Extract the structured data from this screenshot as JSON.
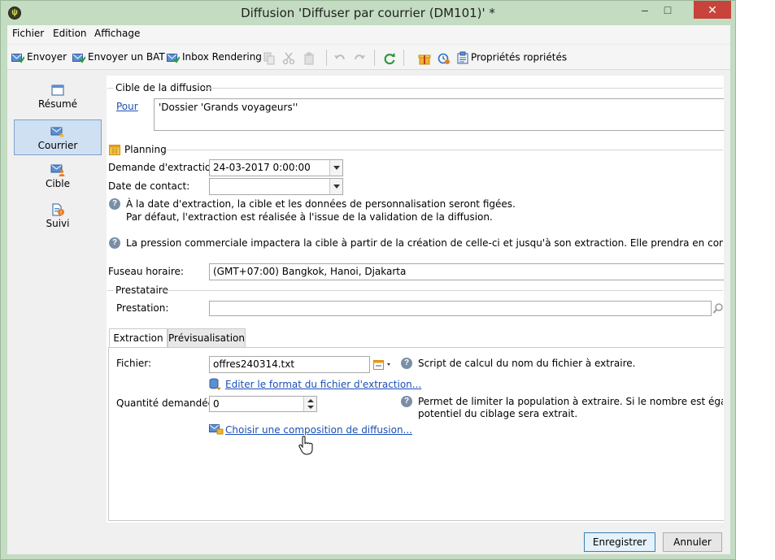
{
  "window": {
    "title": "Diffusion 'Diffuser par courrier (DM101)' *",
    "controls": {
      "minimize": "–",
      "maximize": "□",
      "close": "✕"
    }
  },
  "menu": [
    "Fichier",
    "Edition",
    "Affichage"
  ],
  "toolbar": {
    "send": "Envoyer",
    "send_proof": "Envoyer un BAT",
    "inbox_rendering": "Inbox Rendering",
    "properties": "Propriétés ropriétés"
  },
  "sidebar": {
    "items": [
      {
        "label": "Résumé",
        "icon": "summary-icon"
      },
      {
        "label": "Courrier",
        "icon": "mail-icon"
      },
      {
        "label": "Cible",
        "icon": "target-icon"
      },
      {
        "label": "Suivi",
        "icon": "tracking-icon"
      }
    ],
    "active": "Courrier"
  },
  "target_section": {
    "title": "Cible de la diffusion",
    "to_link": "Pour",
    "to_value": "'Dossier 'Grands voyageurs''"
  },
  "planning": {
    "title": "Planning",
    "extraction_label": "Demande d'extraction:",
    "extraction_value": "24-03-2017 0:00:00",
    "contact_label": "Date de contact:",
    "contact_value": "",
    "info_line1": "À la date d'extraction, la cible et les données de personnalisation seront figées.",
    "info_line2": "Par défaut, l'extraction est réalisée à l'issue de la validation de la diffusion.",
    "pressure_info": "La pression commerciale impactera la cible à partir de la création de celle-ci et jusqu'à son extraction. Elle prendra en compte la date de con",
    "timezone_label": "Fuseau horaire:",
    "timezone_value": "(GMT+07:00) Bangkok, Hanoi, Djakarta"
  },
  "provider": {
    "title": "Prestataire",
    "service_label": "Prestation:",
    "service_value": ""
  },
  "tabs": [
    "Extraction",
    "Prévisualisation"
  ],
  "extraction_tab": {
    "file_label": "Fichier:",
    "file_value": "offres240314.txt",
    "file_help": "Script de calcul du nom du fichier à extraire.",
    "edit_format_link": "Editer le format du fichier d'extraction...",
    "quantity_label": "Quantité demandée:",
    "quantity_value": "0",
    "quantity_help_line1": "Permet de limiter la population à extraire. Si le nombre est égal à zéro to",
    "quantity_help_line2": "potentiel du ciblage sera extrait.",
    "composition_link": "Choisir une composition de diffusion..."
  },
  "footer": {
    "save": "Enregistrer",
    "cancel": "Annuler"
  },
  "colors": {
    "titlebar": "#c3dcc2",
    "close": "#c7433b",
    "link": "#1a4fb5",
    "selection": "#cfe0f2"
  }
}
